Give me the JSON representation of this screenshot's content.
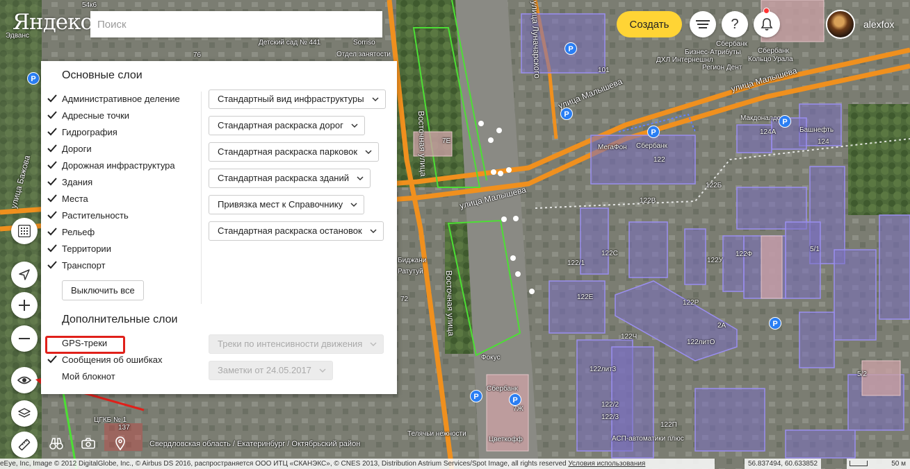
{
  "header": {
    "logo": "Яндекс",
    "search_placeholder": "Поиск",
    "create_label": "Создать",
    "help_label": "?",
    "username": "alexfox"
  },
  "layers_panel": {
    "main_title": "Основные слои",
    "main_layers": [
      {
        "label": "Административное деление",
        "checked": true
      },
      {
        "label": "Адресные точки",
        "checked": true
      },
      {
        "label": "Гидрография",
        "checked": true
      },
      {
        "label": "Дороги",
        "checked": true
      },
      {
        "label": "Дорожная инфраструктура",
        "checked": true
      },
      {
        "label": "Здания",
        "checked": true
      },
      {
        "label": "Места",
        "checked": true
      },
      {
        "label": "Растительность",
        "checked": true
      },
      {
        "label": "Рельеф",
        "checked": true
      },
      {
        "label": "Территории",
        "checked": true
      },
      {
        "label": "Транспорт",
        "checked": true
      }
    ],
    "style_selects": [
      "Стандартный вид инфраструктуры",
      "Стандартная раскраска дорог",
      "Стандартная раскраска парковок",
      "Стандартная раскраска зданий",
      "Привязка мест к Справочнику",
      "Стандартная раскраска остановок"
    ],
    "disable_all_label": "Выключить все",
    "extra_title": "Дополнительные слои",
    "extra_layers": [
      {
        "label": "GPS-треки",
        "checked": false
      },
      {
        "label": "Сообщения об ошибках",
        "checked": true
      },
      {
        "label": "Мой блокнот",
        "checked": false
      }
    ],
    "extra_selects": [
      "Треки по интенсивности движения",
      "Заметки от 24.05.2017"
    ]
  },
  "map_labels": {
    "street_1": "улица Малышева",
    "street_2": "улица Малышева",
    "street_3": "улица Малышева",
    "street_4": "Восточная улица",
    "street_5": "Восточная улица",
    "street_6": "улица Бажова",
    "street_7": "улица Луначарского",
    "poi_1": "Детский сад № 441",
    "poi_2": "Отдел занятости",
    "poi_3": "Sorriso",
    "poi_4": "Сбербанк",
    "poi_5": "Бизнес-Атрибуты",
    "poi_6": "ДХЛ Интернешнл",
    "poi_7": "Кольцо Урала",
    "poi_8": "Регион Дент",
    "poi_9": "Макдоналдс",
    "poi_10": "Башнефть",
    "poi_11": "МегаФон",
    "poi_12": "Сбербанк",
    "poi_13": "Фокус",
    "poi_14": "Сбербанк",
    "poi_15": "Цветкофф",
    "poi_16": "Телячьи нежности",
    "poi_17": "АСП-автоматики плюс",
    "poi_18": "ЦГКБ № 1",
    "poi_19": "Эдванс",
    "poi_20": "Ратутуй",
    "poi_21": "Биджани",
    "poi_22": "Сбербанк",
    "bld_1": "101",
    "bld_2": "122",
    "bld_3": "124А",
    "bld_4": "124",
    "bld_5": "122Б",
    "bld_6": "122В",
    "bld_7": "122С",
    "bld_8": "122/1",
    "bld_9": "122У",
    "bld_10": "122Ф",
    "bld_11": "5/1",
    "bld_12": "122Е",
    "bld_13": "122Р",
    "bld_14": "2А",
    "bld_15": "122Ч",
    "bld_16": "122литО",
    "bld_17": "122лит3",
    "bld_18": "122/2",
    "bld_19": "122/3",
    "bld_20": "122П",
    "bld_21": "5/2",
    "bld_22": "7Е",
    "bld_23": "7Ж",
    "bld_24": "137",
    "bld_25": "76",
    "bld_26": "72",
    "bld_27": "54к6"
  },
  "footer": {
    "breadcrumb": "Свердловская область / Екатеринбург / Октябрьский район",
    "copyright": "eEye, Inc, Image © 2012 DigitalGlobe, Inc., © Airbus DS 2016, распространяется ООО ИТЦ «СКАНЭКС», © CNES 2013, Distribution Astrium Services/Spot Image, all rights reserved",
    "terms": "Условия использования",
    "coords": "56.837494, 60.633852",
    "scale": "50 м"
  },
  "colors": {
    "accent": "#ffd435",
    "highlight": "#e0201a",
    "road_orange": "#f0901e",
    "building_violet": "#8a7fd8",
    "link_blue": "#2a7ef3"
  }
}
